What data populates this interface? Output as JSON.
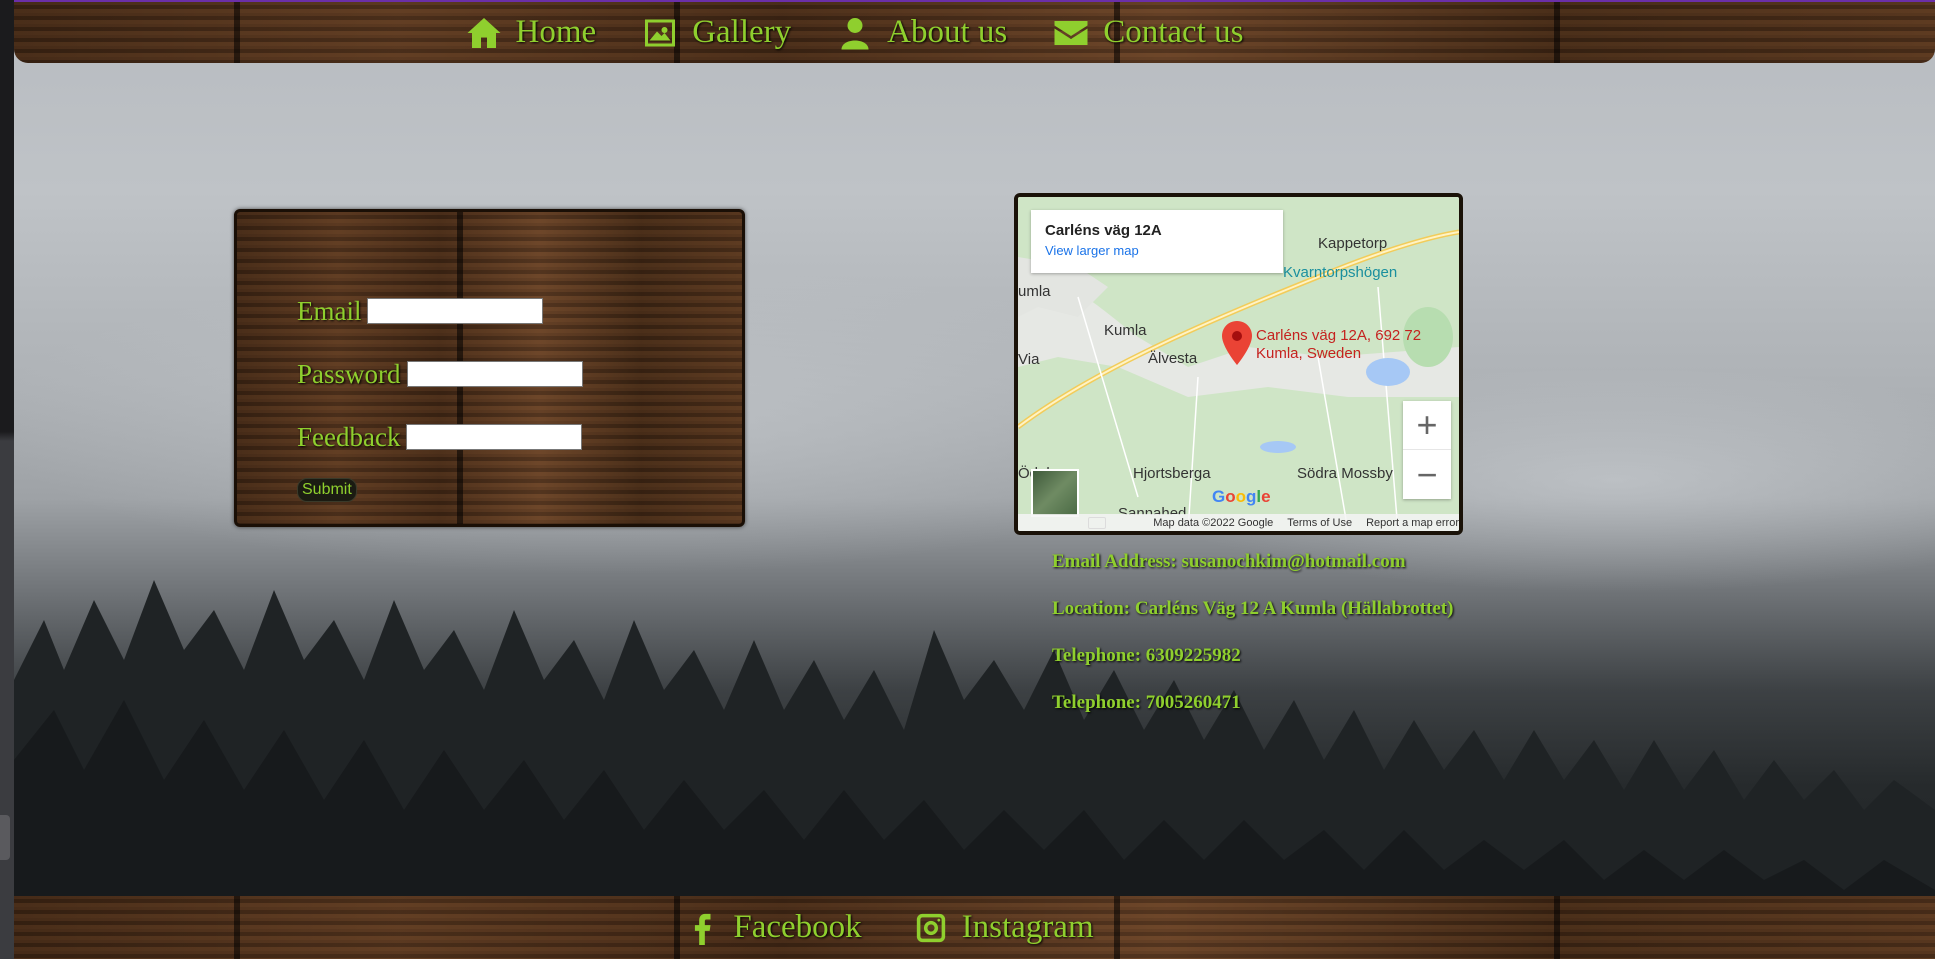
{
  "nav": {
    "items": [
      {
        "label": "Home",
        "icon": "home-icon"
      },
      {
        "label": "Gallery",
        "icon": "image-icon"
      },
      {
        "label": "About us",
        "icon": "user-icon"
      },
      {
        "label": "Contact us",
        "icon": "envelope-icon"
      }
    ]
  },
  "form": {
    "email_label": "Email",
    "password_label": "Password",
    "feedback_label": "Feedback",
    "submit_label": "Submit"
  },
  "map": {
    "card_title": "Carléns väg 12A",
    "card_link": "View larger map",
    "pin_label": "Carléns väg 12A, 692 72 Kumla, Sweden",
    "places": [
      "Kappetorp",
      "Kvarntorpshögen",
      "umla",
      "Kumla",
      "Älvesta",
      "Via",
      "Hjortsberga",
      "Södra Mossby",
      "Ödeby",
      "Sannahed"
    ],
    "google_logo": "Google",
    "zoom_in": "+",
    "zoom_out": "−",
    "attribution": {
      "map_data": "Map data ©2022 Google",
      "terms": "Terms of Use",
      "report": "Report a map error"
    }
  },
  "contact": {
    "email": "Email Address: susanochkim@hotmail.com",
    "location": "Location: Carléns Väg 12 A Kumla (Hällabrottet)",
    "phone1": "Telephone: 6309225982",
    "phone2": "Telephone: 7005260471"
  },
  "footer": {
    "facebook": "Facebook",
    "instagram": "Instagram"
  },
  "colors": {
    "accent": "#8fcf2e",
    "wood": "#4a2e1a",
    "pin": "#ea4335"
  }
}
